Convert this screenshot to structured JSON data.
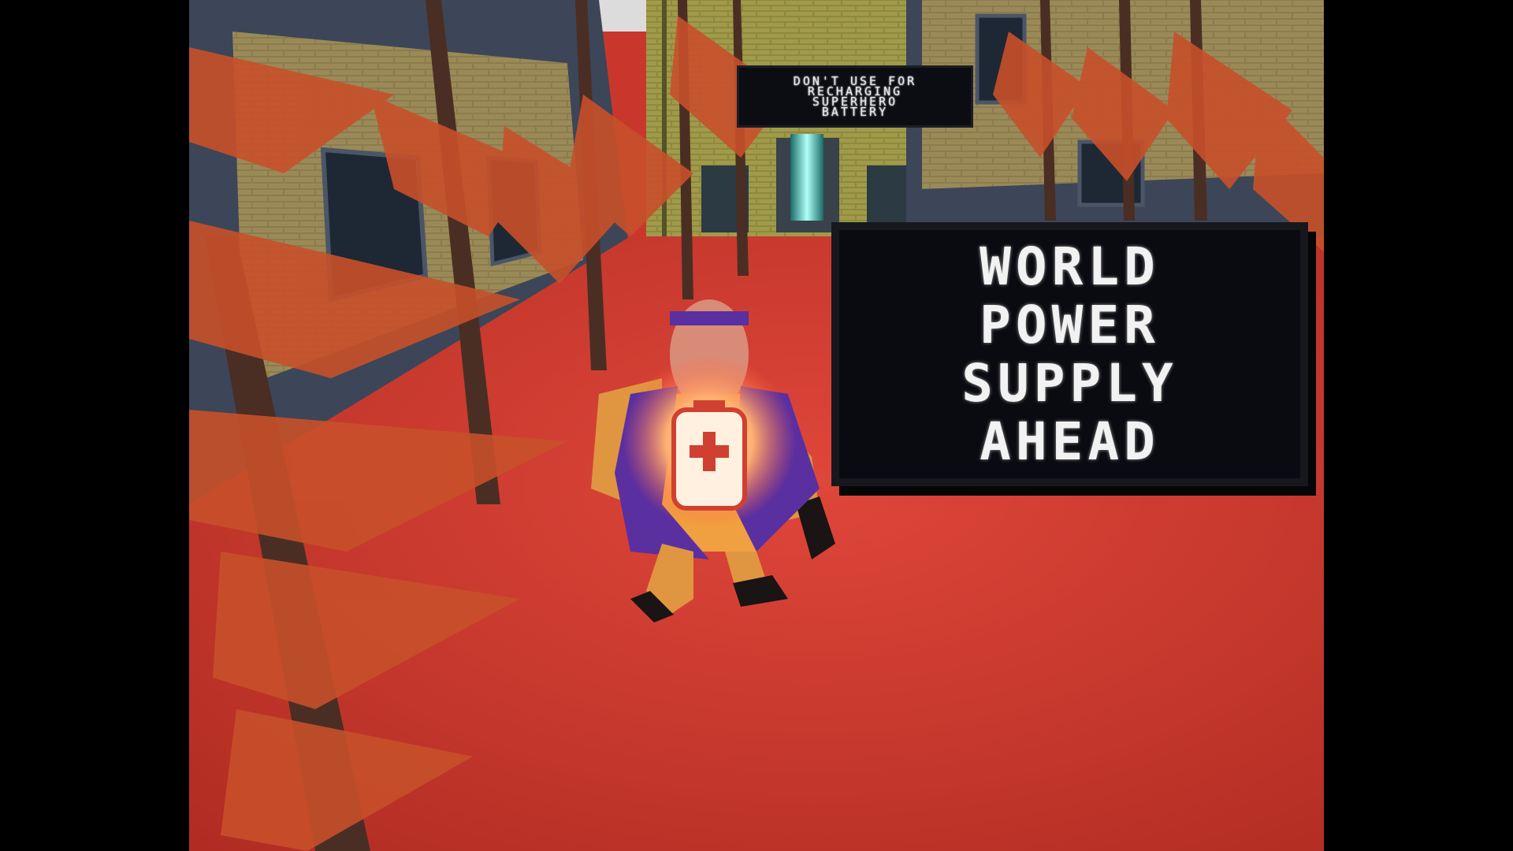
{
  "scene": {
    "small_sign_lines": [
      "DON'T USE FOR",
      "RECHARGING",
      "SUPERHERO",
      "BATTERY"
    ],
    "big_sign_lines": [
      "WORLD",
      "POWER",
      "SUPPLY",
      "AHEAD"
    ],
    "colors": {
      "ground": "#c9372c",
      "brick": "#8a7a4e",
      "sign_bg": "#0a0b10",
      "sign_text": "#f2f2f2",
      "hero_suit": "#f0a040",
      "hero_cape": "#5a2fa0",
      "battery_glow": "#ffe0c0",
      "tube_glow": "#40f0e0"
    },
    "icons": [
      "battery-plus-emblem-icon"
    ]
  }
}
